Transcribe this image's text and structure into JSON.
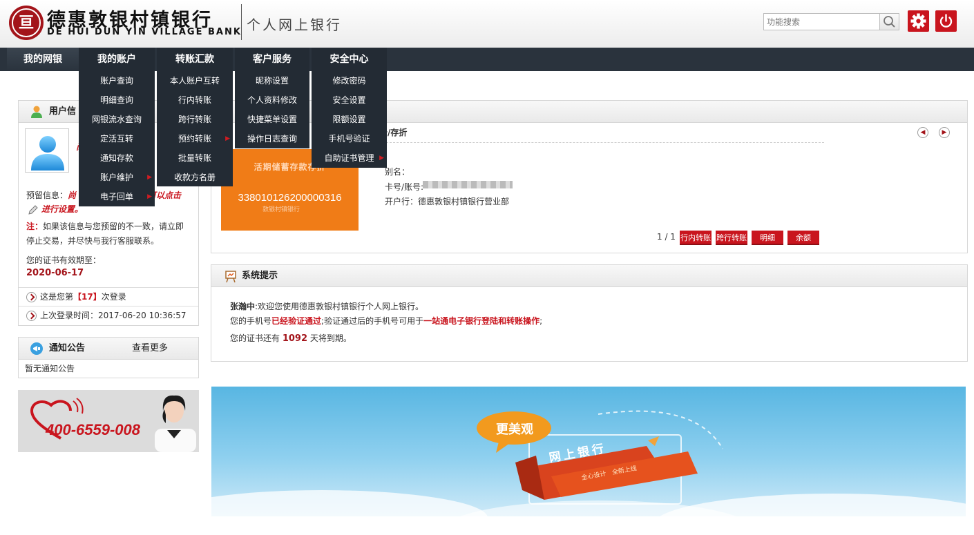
{
  "header": {
    "logo_glyph": "亘",
    "bank_name_cn": "德惠敦银村镇银行",
    "bank_name_en": "DE HUI DUN YIN VILLAGE BANK",
    "system_title": "个人网上银行",
    "search_placeholder": "功能搜索",
    "colors": {
      "brand_red": "#c9151e",
      "nav_bg": "#2a333d"
    }
  },
  "nav": {
    "items": [
      {
        "label": "我的网银"
      },
      {
        "label": "我的账户"
      },
      {
        "label": "转账汇款"
      },
      {
        "label": "客户服务"
      },
      {
        "label": "安全中心"
      }
    ]
  },
  "menus": {
    "account": [
      "账户查询",
      "明细查询",
      "网银流水查询",
      "定活互转",
      "通知存款",
      "账户维护",
      "电子回单"
    ],
    "transfer": [
      "本人账户互转",
      "行内转账",
      "跨行转账",
      "预约转账",
      "批量转账",
      "收款方名册"
    ],
    "service": [
      "昵称设置",
      "个人资料修改",
      "快捷菜单设置",
      "操作日志查询"
    ],
    "security": [
      "修改密码",
      "安全设置",
      "限额设置",
      "手机号验证",
      "自助证书管理"
    ]
  },
  "user_panel": {
    "title": "用户信",
    "name_hidden": "尚",
    "prefix_label": "预留信息：",
    "prefix_value_1": "尚",
    "prefix_value_2": "可以点击",
    "prefix_value_3": "进行设置。",
    "notice_label": "注：",
    "notice_text": "如果该信息与您预留的不一致，请立即停止交易，并尽快与我行客服联系。",
    "cert_valid_label": "您的证书有效期至：",
    "cert_valid_date": "2020-06-17",
    "login_count_prefix": "这是您第",
    "login_count": "【17】",
    "login_count_suffix": "次登录",
    "last_login_label": "上次登录时间：",
    "last_login_time": "2017-06-20 10:36:57"
  },
  "notice_panel": {
    "title": "通知公告",
    "more_label": "查看更多",
    "empty_text": "暂无通知公告"
  },
  "hotline": {
    "number": "400-6559-008"
  },
  "account_card": {
    "tab_label": "卡/存折",
    "card_caption": "活期储蓄存款存折",
    "card_number": "338010126200000316",
    "card_bank_mark": "敦银村镇银行",
    "alias_label": "别名：",
    "account_label": "卡号/账号:",
    "branch_label": "开户行：",
    "branch_value": "德惠敦银村镇银行营业部",
    "page_indicator": "1 / 1",
    "buttons": [
      "行内转账",
      "跨行转账",
      "明细",
      "余额"
    ]
  },
  "system_tips": {
    "title": "系统提示",
    "user_name": "张瀚中",
    "welcome_text": ":欢迎您使用德惠敦银村镇银行个人网上银行。",
    "phone_prefix": "您的手机号",
    "phone_status": "已经验证通过",
    "phone_middle": ";验证通过后的手机号可用于",
    "phone_feature": "一站通电子银行登陆和转账操作",
    "phone_suffix": ";",
    "cert_prefix": "您的证书还有",
    "cert_days": "1092",
    "cert_suffix": "天将到期。"
  },
  "promo": {
    "bubble": "更美观",
    "ribbon": "网上银行",
    "slogan_1": "全心设计",
    "slogan_2": "全新上线"
  }
}
